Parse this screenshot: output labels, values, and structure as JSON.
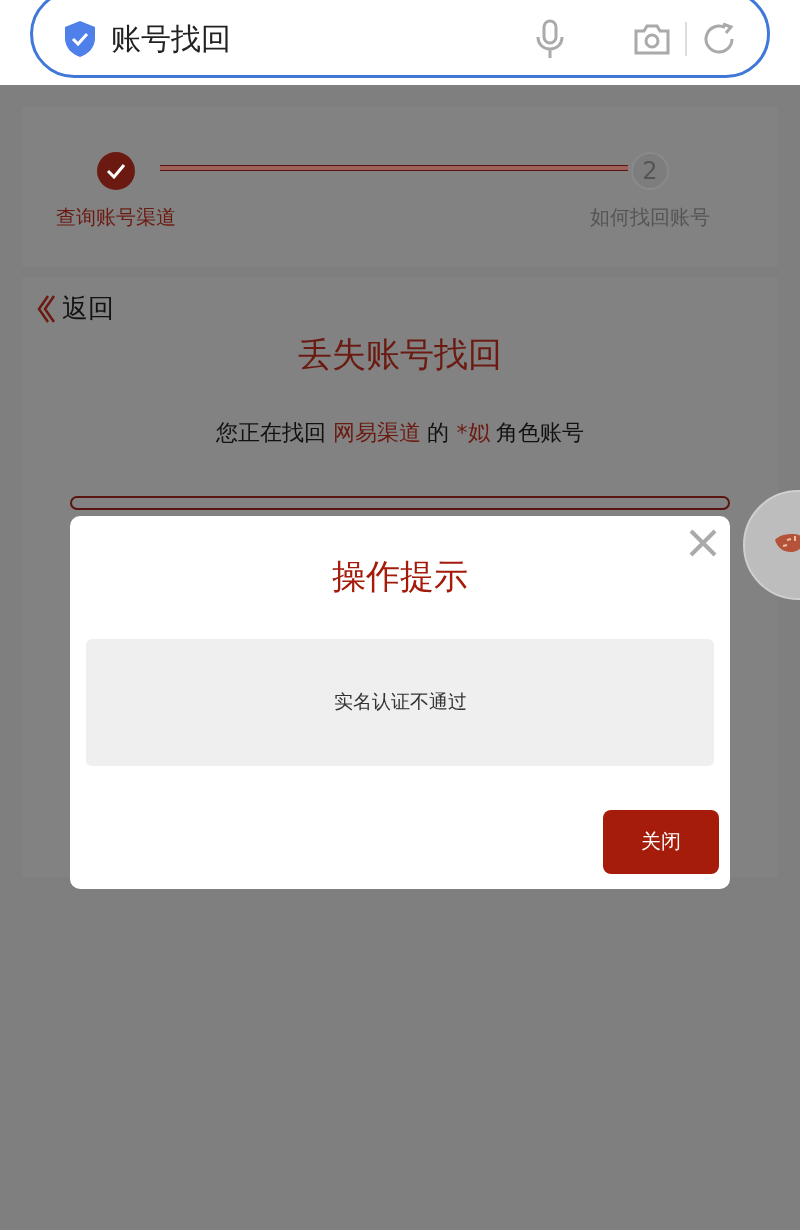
{
  "search_bar": {
    "value": "账号找回"
  },
  "steps": [
    {
      "label": "查询账号渠道",
      "done": true
    },
    {
      "label": "如何找回账号",
      "done": false,
      "number": "2"
    }
  ],
  "back_link": "返回",
  "page_title": "丢失账号找回",
  "notice": [
    {
      "text": "您正在找回 ",
      "highlight": false
    },
    {
      "text": "网易渠道",
      "highlight": true
    },
    {
      "text": " 的 ",
      "highlight": false
    },
    {
      "text": "*姒",
      "highlight": true
    },
    {
      "text": " 角色账号",
      "highlight": false
    }
  ],
  "dialog": {
    "title": "操作提示",
    "message": "实名认证不通过",
    "button": "关闭"
  }
}
